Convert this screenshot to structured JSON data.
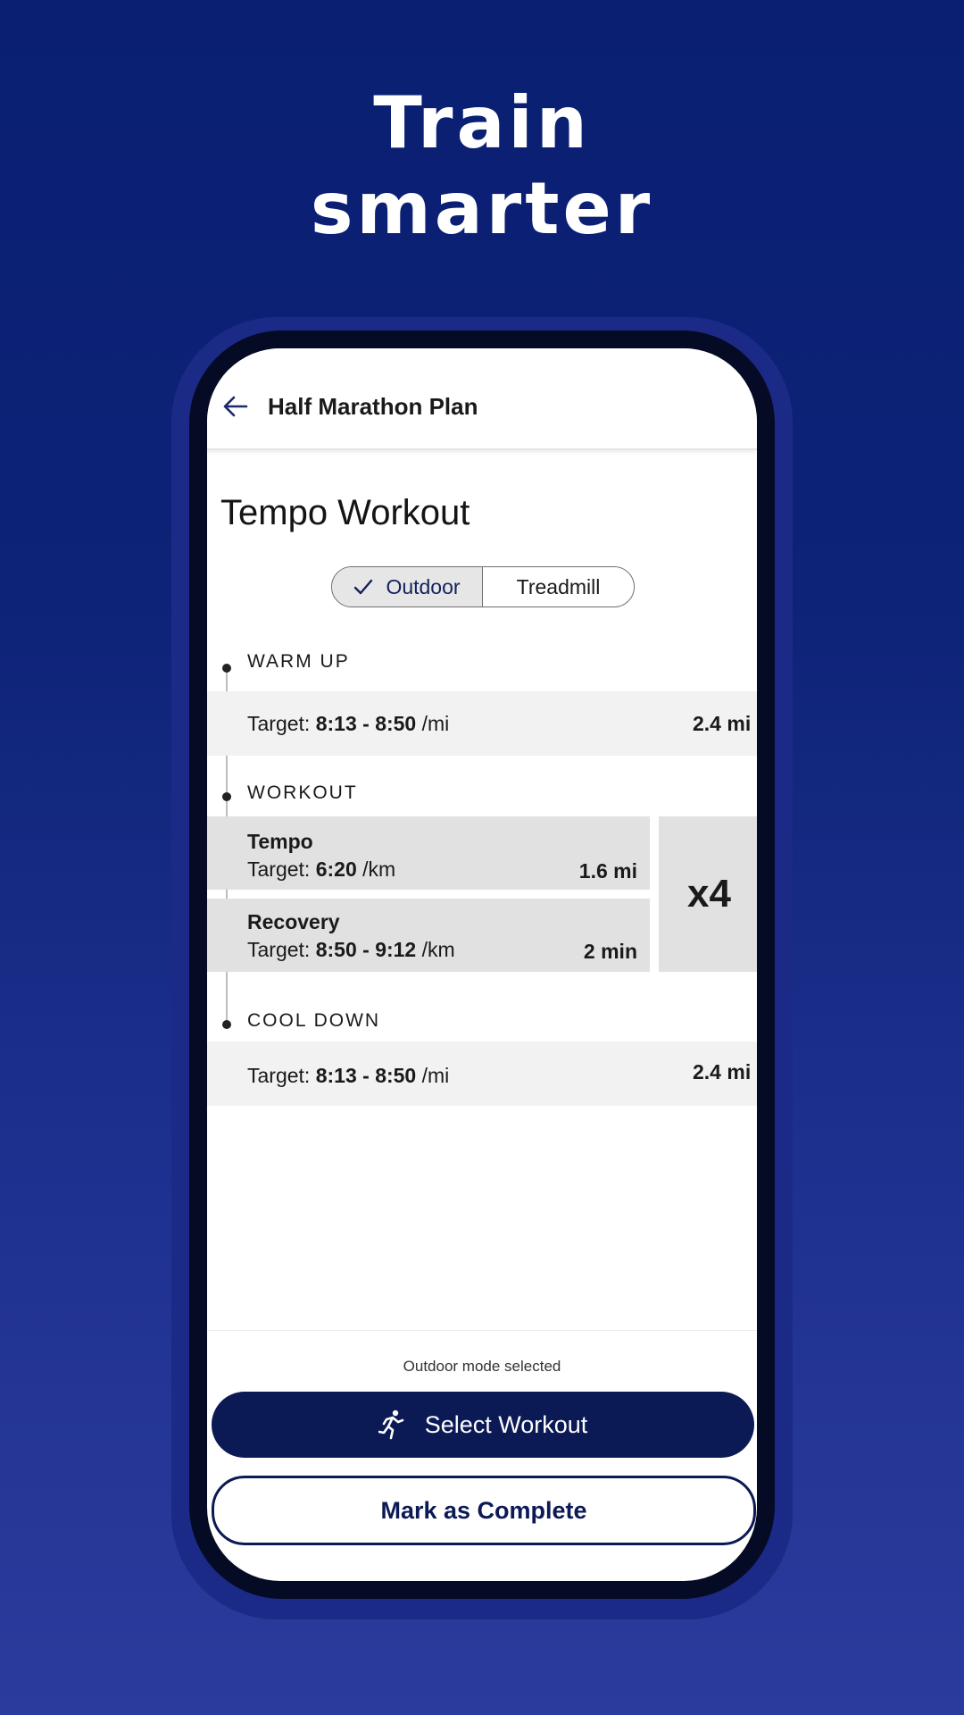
{
  "hero": {
    "line1": "Train",
    "line2": "smarter"
  },
  "app_bar": {
    "back_icon": "arrow-left-icon",
    "title": "Half Marathon Plan"
  },
  "page_title": "Tempo Workout",
  "toggle": {
    "options": [
      "Outdoor",
      "Treadmill"
    ],
    "selected": "Outdoor",
    "check_icon": "check-icon"
  },
  "sections": {
    "warm_up": {
      "label": "WARM UP",
      "target_prefix": "Target: ",
      "pace": "8:13 - 8:50",
      "unit": " /mi",
      "distance": "2.4 mi"
    },
    "workout": {
      "label": "WORKOUT",
      "repeat": "x4",
      "steps": [
        {
          "name": "Tempo",
          "target_prefix": "Target: ",
          "pace": "6:20",
          "unit": " /km",
          "amount": "1.6 mi"
        },
        {
          "name": "Recovery",
          "target_prefix": "Target: ",
          "pace": "8:50 - 9:12",
          "unit": " /km",
          "amount": "2 min"
        }
      ]
    },
    "cool_down": {
      "label": "COOL DOWN",
      "target_prefix": "Target: ",
      "pace": "8:13 - 8:50",
      "unit": " /mi",
      "distance": "2.4 mi"
    }
  },
  "footer": {
    "mode_text": "Outdoor mode selected",
    "select_button": "Select Workout",
    "select_icon": "runner-icon",
    "complete_button": "Mark as Complete"
  },
  "colors": {
    "background_top": "#0a1f72",
    "background_bottom": "#2b3b9d",
    "primary": "#0b1a54",
    "row_light": "#f2f2f2",
    "row_dark": "#e1e1e1"
  }
}
